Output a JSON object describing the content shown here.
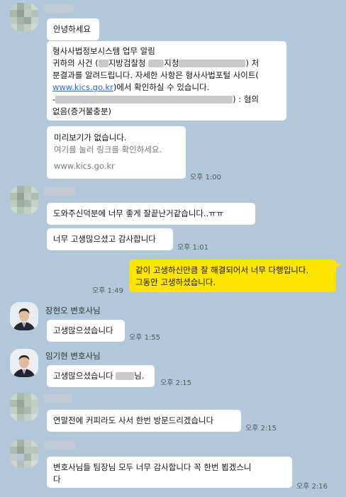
{
  "messages": {
    "m1": {
      "text": "안녕하세요"
    },
    "m2": {
      "line1": "형사사법정보시스템 업무 알림",
      "line2a": "귀하의 사건 (",
      "line2b": "지방검찰청",
      "line2c": "지청",
      "line2d": ") 처",
      "line3": "분결과를 알려드립니다. 자세한 사항은 형사사법포털 사이트(",
      "link": "www.kics.go.kr",
      "line4": ")에서 확인하실 수 있습니다.",
      "line5a": "-",
      "line5b": ") : 혐의",
      "line6": "없음(증거불충분)"
    },
    "m3": {
      "title": "미리보기가 없습니다.",
      "hint": "여기를 눌러 링크를 확인하세요.",
      "domain": "www.kics.go.kr",
      "time": "오후 1:00"
    },
    "m4": {
      "text": "도와주신덕분에 너무 좋게 잘끝난거같습니다..ㅠㅠ"
    },
    "m5": {
      "text": "너무 고생많으셨고 감사합니다",
      "time": "오후 1:01"
    },
    "m6": {
      "line1": "같이 고생하신만큼 잘 해결되어서 너무 다행입니다.",
      "line2": "그동안 고생하셨습니다.",
      "time": "오후 1:49"
    },
    "m7": {
      "sender": "장현오 변호사님",
      "text": "고생많으셨습니다",
      "time": "오후 1:55"
    },
    "m8": {
      "sender": "임기현 변호사님",
      "text_a": "고생많으셨습니다",
      "text_b": "님.",
      "time": "오후 2:15"
    },
    "m9": {
      "text": "연말전에 커피라도 사서 한번 방문드리겠습니다",
      "time": "오후 2:15"
    },
    "m10": {
      "line1": "변호사님들 팀장님 모두 너무 감사합니다 꼭 한번 뵙겠스니",
      "line2": "다",
      "time": "오후 2:16"
    }
  },
  "colors": {
    "background": "#b2c7d9",
    "my_bubble": "#fee500",
    "their_bubble": "#ffffff",
    "link": "#2a6ac8"
  }
}
